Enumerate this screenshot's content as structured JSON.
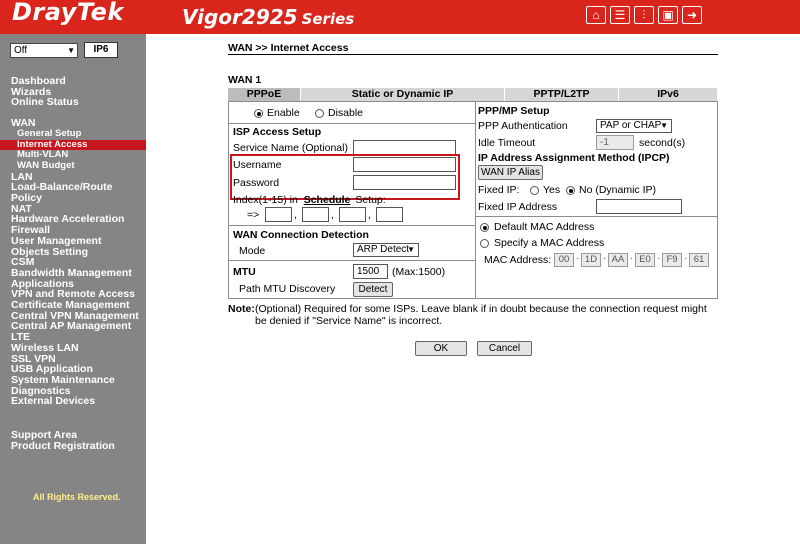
{
  "header": {
    "brand": "DrayTek",
    "model": "Vigor2925",
    "series": "Series"
  },
  "sidebar": {
    "language": "Off",
    "ipv6_badge": "IP6",
    "menu": [
      "Dashboard",
      "Wizards",
      "Online Status",
      "WAN",
      "General Setup",
      "Internet Access",
      "Multi-VLAN",
      "WAN Budget",
      "LAN",
      "Load-Balance/Route Policy",
      "NAT",
      "Hardware Acceleration",
      "Firewall",
      "User Management",
      "Objects Setting",
      "CSM",
      "Bandwidth Management",
      "Applications",
      "VPN and Remote Access",
      "Certificate Management",
      "Central VPN Management",
      "Central AP Management",
      "LTE",
      "Wireless LAN",
      "SSL VPN",
      "USB Application",
      "System Maintenance",
      "Diagnostics",
      "External Devices",
      "Support Area",
      "Product Registration"
    ],
    "footer": "All Rights Reserved."
  },
  "main": {
    "breadcrumb": "WAN >> Internet Access",
    "wan_label": "WAN 1",
    "tabs": [
      "PPPoE",
      "Static or Dynamic IP",
      "PPTP/L2TP",
      "IPv6"
    ],
    "left": {
      "enable": "Enable",
      "disable": "Disable",
      "isp_title": "ISP Access Setup",
      "service_name": "Service Name (Optional)",
      "username": "Username",
      "password": "Password",
      "index_label": "Index(1-15) in",
      "schedule_link": "Schedule",
      "setup_label": "Setup:",
      "arrow": "=>",
      "comma": ",",
      "wcd_title": "WAN Connection Detection",
      "mode_label": "Mode",
      "mode_value": "ARP Detect",
      "mtu_title": "MTU",
      "mtu_value": "1500",
      "mtu_max": "(Max:1500)",
      "path_mtu": "Path MTU Discovery",
      "detect_btn": "Detect"
    },
    "right": {
      "ppp_title": "PPP/MP Setup",
      "ppp_auth_label": "PPP Authentication",
      "ppp_auth_value": "PAP or CHAP",
      "idle_label": "Idle Timeout",
      "idle_value": "-1",
      "idle_unit": "second(s)",
      "ipcp_title": "IP Address Assignment Method (IPCP)",
      "alias_btn": "WAN IP Alias",
      "fixed_ip_label": "Fixed IP:",
      "yes": "Yes",
      "no": "No (Dynamic IP)",
      "fixed_ip_addr": "Fixed IP Address",
      "default_mac": "Default MAC Address",
      "specify_mac": "Specify a MAC Address",
      "mac_label": "MAC Address:",
      "mac": [
        "00",
        "1D",
        "AA",
        "E0",
        "F9",
        "61"
      ],
      "mac_sep": "·"
    },
    "note_label": "Note:",
    "note_text": "(Optional) Required for some ISPs. Leave blank if in doubt because the connection request might be denied if \"Service Name\" is incorrect.",
    "ok": "OK",
    "cancel": "Cancel"
  }
}
